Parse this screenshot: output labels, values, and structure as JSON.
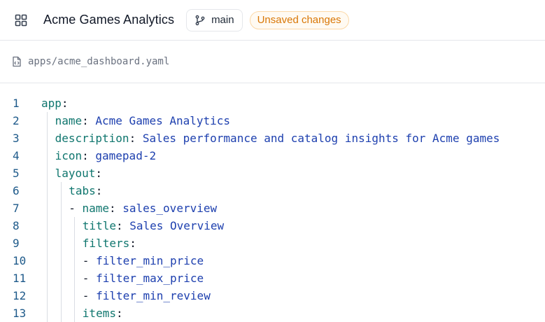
{
  "header": {
    "title": "Acme Games Analytics",
    "branch": "main",
    "status_badge": "Unsaved changes",
    "icons": {
      "menu": "grid-icon",
      "branch": "git-branch-icon"
    },
    "colors": {
      "badge_text": "#d97706",
      "badge_border": "#fcd9a8"
    }
  },
  "file": {
    "path": "apps/acme_dashboard.yaml",
    "icon": "file-code-icon"
  },
  "editor": {
    "lines": [
      {
        "n": "1",
        "indent": 0,
        "dash": "",
        "key": "app",
        "value": ""
      },
      {
        "n": "2",
        "indent": 1,
        "dash": "",
        "key": "name",
        "value": "Acme Games Analytics"
      },
      {
        "n": "3",
        "indent": 1,
        "dash": "",
        "key": "description",
        "value": "Sales performance and catalog insights for Acme games"
      },
      {
        "n": "4",
        "indent": 1,
        "dash": "",
        "key": "icon",
        "value": "gamepad-2"
      },
      {
        "n": "5",
        "indent": 1,
        "dash": "",
        "key": "layout",
        "value": ""
      },
      {
        "n": "6",
        "indent": 2,
        "dash": "",
        "key": "tabs",
        "value": ""
      },
      {
        "n": "7",
        "indent": 2,
        "dash": "- ",
        "key": "name",
        "value": "sales_overview"
      },
      {
        "n": "8",
        "indent": 3,
        "dash": "",
        "key": "title",
        "value": "Sales Overview"
      },
      {
        "n": "9",
        "indent": 3,
        "dash": "",
        "key": "filters",
        "value": ""
      },
      {
        "n": "10",
        "indent": 3,
        "dash": "- ",
        "key": "",
        "value": "filter_min_price"
      },
      {
        "n": "11",
        "indent": 3,
        "dash": "- ",
        "key": "",
        "value": "filter_max_price"
      },
      {
        "n": "12",
        "indent": 3,
        "dash": "- ",
        "key": "",
        "value": "filter_min_review"
      },
      {
        "n": "13",
        "indent": 3,
        "dash": "",
        "key": "items",
        "value": ""
      }
    ]
  }
}
